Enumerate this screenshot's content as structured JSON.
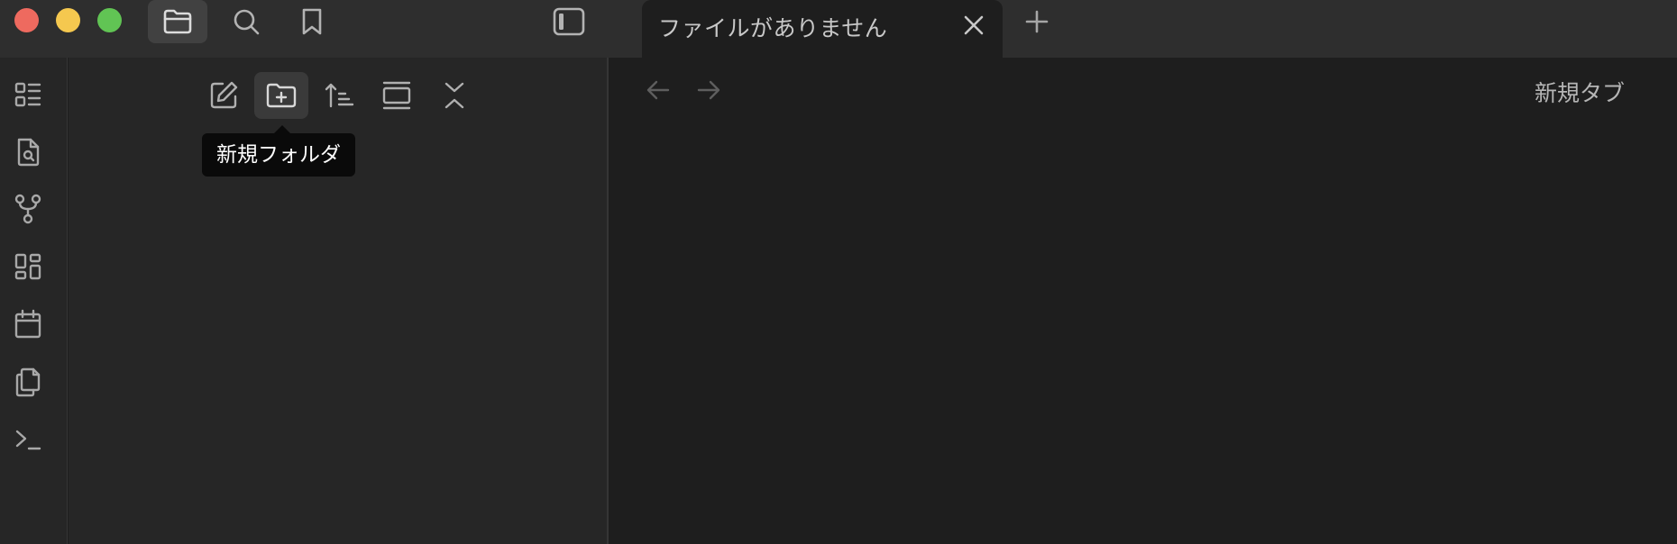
{
  "window": {
    "traffic_lights": [
      "close",
      "minimize",
      "zoom"
    ]
  },
  "titlebar": {
    "sidebar_tabs": [
      {
        "icon": "folder-icon",
        "active": true
      },
      {
        "icon": "search-icon",
        "active": false
      },
      {
        "icon": "bookmark-icon",
        "active": false
      }
    ],
    "toggle_icon": "sidebar-toggle-icon",
    "tab": {
      "title": "ファイルがありません"
    },
    "new_tab_icon": "plus-icon"
  },
  "ribbon": {
    "icons": [
      "outline-icon",
      "file-search-icon",
      "graph-icon",
      "canvas-icon",
      "calendar-icon",
      "copy-icon",
      "terminal-icon"
    ]
  },
  "explorer": {
    "nav_buttons": [
      "new-note-icon",
      "new-folder-icon",
      "sort-icon",
      "reveal-icon",
      "collapse-all-icon"
    ],
    "tooltip": "新規フォルダ"
  },
  "main": {
    "view_title": "新規タブ"
  },
  "colors": {
    "background": "#1e1e1e",
    "sidebar": "#262626",
    "titlebar": "#2e2e2e",
    "close": "#ee6a5f",
    "minimize": "#f5c84f",
    "zoom": "#61c454"
  }
}
